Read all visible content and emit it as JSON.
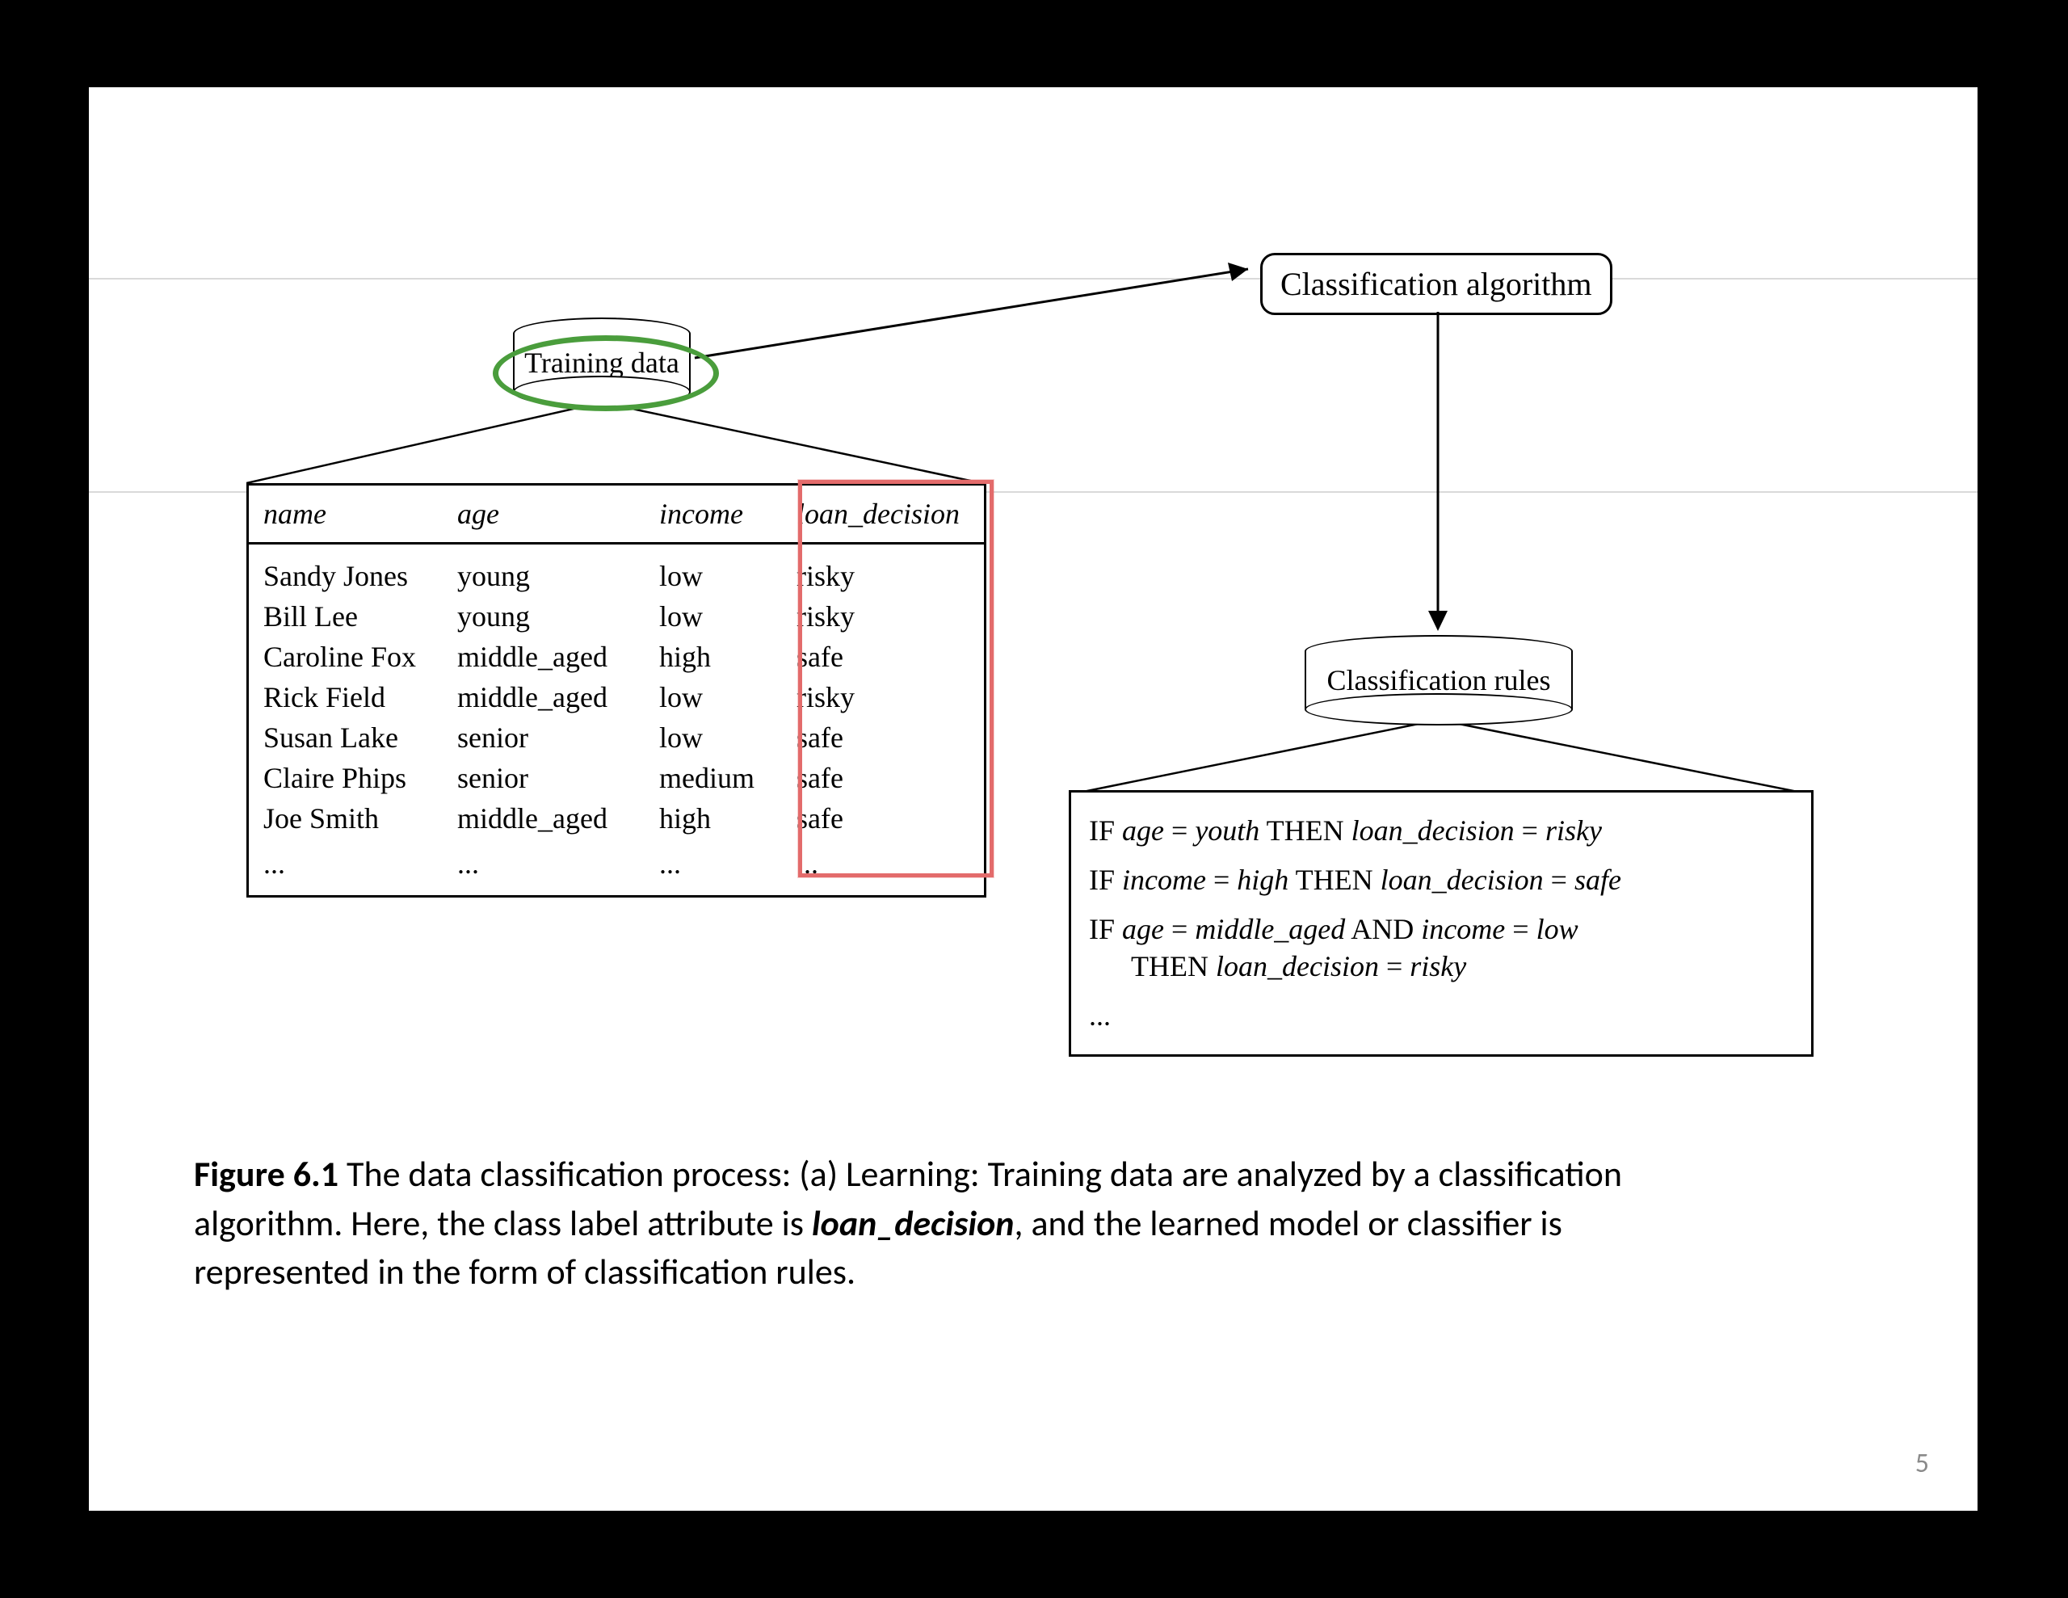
{
  "training_data": {
    "label": "Training data",
    "headers": {
      "name": "name",
      "age": "age",
      "income": "income",
      "loan_decision": "loan_decision"
    },
    "rows": [
      {
        "name": "Sandy Jones",
        "age": "young",
        "income": "low",
        "loan_decision": "risky"
      },
      {
        "name": "Bill Lee",
        "age": "young",
        "income": "low",
        "loan_decision": "risky"
      },
      {
        "name": "Caroline Fox",
        "age": "middle_aged",
        "income": "high",
        "loan_decision": "safe"
      },
      {
        "name": "Rick Field",
        "age": "middle_aged",
        "income": "low",
        "loan_decision": "risky"
      },
      {
        "name": "Susan Lake",
        "age": "senior",
        "income": "low",
        "loan_decision": "safe"
      },
      {
        "name": "Claire Phips",
        "age": "senior",
        "income": "medium",
        "loan_decision": "safe"
      },
      {
        "name": "Joe Smith",
        "age": "middle_aged",
        "income": "high",
        "loan_decision": "safe"
      }
    ],
    "ellipsis": "..."
  },
  "algorithm_box": {
    "label": "Classification algorithm"
  },
  "rules_data": {
    "label": "Classification rules",
    "kw": {
      "IF": "IF",
      "THEN": "THEN",
      "AND": "AND"
    },
    "rules": [
      {
        "cond_attr": "age",
        "cond_val": "youth",
        "res_attr": "loan_decision",
        "res_val": "risky"
      },
      {
        "cond_attr": "income",
        "cond_val": "high",
        "res_attr": "loan_decision",
        "res_val": "safe"
      }
    ],
    "rule3": {
      "c1_attr": "age",
      "c1_val": "middle_aged",
      "c2_attr": "income",
      "c2_val": "low",
      "res_attr": "loan_decision",
      "res_val": "risky"
    },
    "ellipsis": "..."
  },
  "caption": {
    "figure_label": "Figure 6.1",
    "text_before_em": "  The data classification process: (a) Learning: Training data are analyzed by a classification algorithm. Here, the class label attribute is ",
    "emph": "loan_decision",
    "text_after_em": ", and the learned model or classifier is represented in the form of classification rules."
  },
  "page_number": "5",
  "eq": "="
}
